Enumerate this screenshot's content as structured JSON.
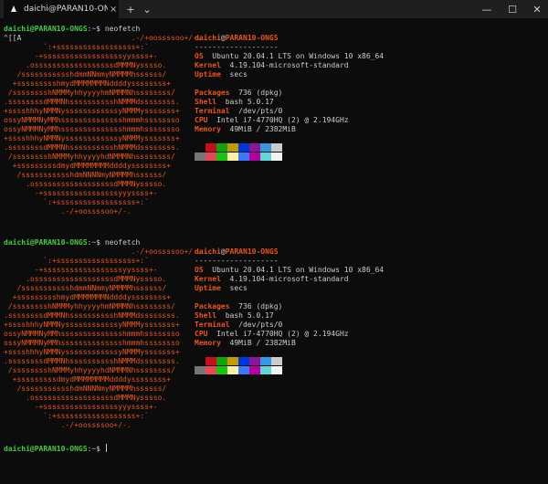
{
  "tab": {
    "title": "daichi@PARAN10-ONGS: ~",
    "close": "×"
  },
  "titlebar": {
    "new_tab": "+",
    "dropdown": "⌄",
    "minimize": "—",
    "maximize": "☐",
    "close": "✕"
  },
  "prompt": {
    "user_host": "daichi@PARAN10-ONGS",
    "colon": ":",
    "path": "~",
    "dollar": "$",
    "cmd": " neofetch"
  },
  "escape_artifact": "^[[A",
  "logo": [
    "                             .-/+oossssoo+/-.",
    "         `:+ssssssssssssssssss+:`",
    "       -+ssssssssssssssssssyyssss+-",
    "     .ossssssssssssssssssdMMMNysssso.",
    "   /ssssssssssshdmmNNmmyNMMMMhssssss/",
    "  +ssssssssshmydMMMMMMMNddddyssssssss+",
    " /sssssssshNMMMyhhyyyyhmNMMMNhssssssss/",
    ".ssssssssdMMMNhsssssssssshNMMMdssssssss.",
    "+sssshhhyNMMNyssssssssssssyNMMMysssssss+",
    "ossyNMMMNyMMhsssssssssssssshmmmhssssssso",
    "ossyNMMMNyMMhsssssssssssssshmmmhssssssso",
    "+sssshhhyNMMNyssssssssssssyNMMMysssssss+",
    ".ssssssssdMMMNhsssssssssshNMMMdssssssss.",
    " /sssssssshNMMMyhhyyyyhdNMMMNhssssssss/",
    "  +sssssssssdmydMMMMMMMMddddyssssssss+",
    "   /ssssssssssshdmNNNNmyNMMMMhssssss/",
    "     .ossssssssssssssssssdMMMNysssso.",
    "       -+sssssssssssssssssyyyssss+-",
    "         `:+ssssssssssssssssss+:`",
    "             .-/+oossssoo+/-."
  ],
  "info": {
    "user": "daichi",
    "at": "@",
    "host": "PARAN10-ONGS",
    "separator": "-------------------",
    "rows": [
      {
        "key": "OS",
        "value": "Ubuntu 20.04.1 LTS on Windows 10 x86_64"
      },
      {
        "key": "Kernel",
        "value": "4.19.104-microsoft-standard"
      },
      {
        "key": "Uptime",
        "value": "secs"
      },
      {
        "key": "",
        "value": ""
      },
      {
        "key": "Packages",
        "value": "736 (dpkg)"
      },
      {
        "key": "Shell",
        "value": "bash 5.0.17"
      },
      {
        "key": "Terminal",
        "value": "/dev/pts/0"
      },
      {
        "key": "CPU",
        "value": "Intel i7-4770HQ (2) @ 2.194GHz"
      },
      {
        "key": "Memory",
        "value": "49MiB / 2382MiB"
      }
    ]
  },
  "palette": [
    "#0c0c0c",
    "#c50f1f",
    "#13a10e",
    "#c19c00",
    "#0037da",
    "#881798",
    "#3a96dd",
    "#cccccc",
    "#767676",
    "#e74856",
    "#16c60c",
    "#f9f1a5",
    "#3b78ff",
    "#b4009e",
    "#61d6d6",
    "#f2f2f2"
  ]
}
